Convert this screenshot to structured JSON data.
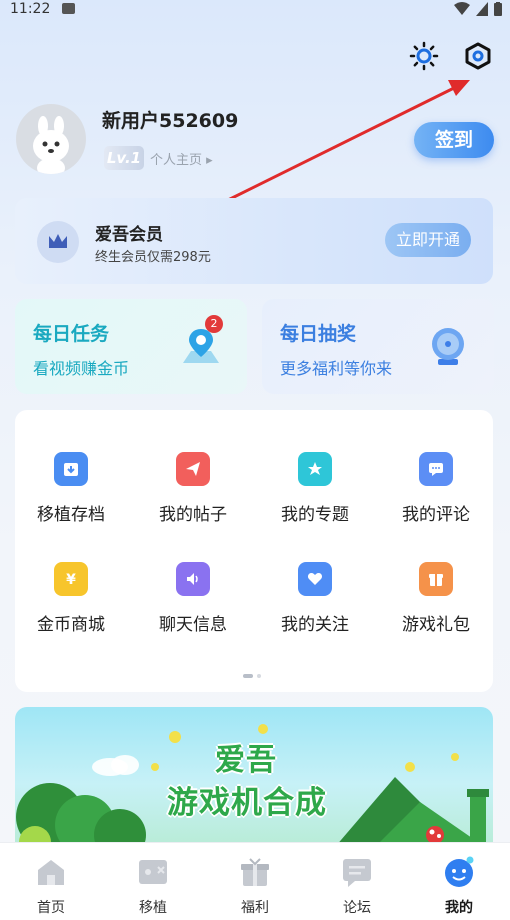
{
  "status_bar": {
    "time": "11:22"
  },
  "header": {
    "settings_icon": "gear-icon",
    "theme_icon": "sun-icon"
  },
  "profile": {
    "username": "新用户552609",
    "level": "Lv.1",
    "homepage_label": "个人主页",
    "checkin_label": "签到"
  },
  "vip": {
    "title": "爱吾会员",
    "subtitle": "终生会员仅需298元",
    "button_label": "立即开通"
  },
  "tasks": {
    "daily": {
      "title": "每日任务",
      "subtitle": "看视频赚金币",
      "badge": "2"
    },
    "lottery": {
      "title": "每日抽奖",
      "subtitle": "更多福利等你来"
    }
  },
  "features": [
    {
      "label": "移植存档",
      "icon": "archive-icon",
      "color": "#4a8df2"
    },
    {
      "label": "我的帖子",
      "icon": "paper-plane-icon",
      "color": "#f25f5c"
    },
    {
      "label": "我的专题",
      "icon": "star-icon",
      "color": "#2ec6d8"
    },
    {
      "label": "我的评论",
      "icon": "comment-icon",
      "color": "#5c8ef5"
    },
    {
      "label": "金币商城",
      "icon": "coin-icon",
      "color": "#f7c52c"
    },
    {
      "label": "聊天信息",
      "icon": "speaker-icon",
      "color": "#8a72f0"
    },
    {
      "label": "我的关注",
      "icon": "heart-icon",
      "color": "#4f8df5"
    },
    {
      "label": "游戏礼包",
      "icon": "gift-icon",
      "color": "#f5924a"
    }
  ],
  "banner": {
    "title_line1": "爱吾",
    "title_line2": "游戏机合成"
  },
  "tab_bar": [
    {
      "label": "首页",
      "icon": "home-icon"
    },
    {
      "label": "移植",
      "icon": "gamepad-icon"
    },
    {
      "label": "福利",
      "icon": "gift-icon"
    },
    {
      "label": "论坛",
      "icon": "forum-icon"
    },
    {
      "label": "我的",
      "icon": "face-icon",
      "active": true
    }
  ]
}
